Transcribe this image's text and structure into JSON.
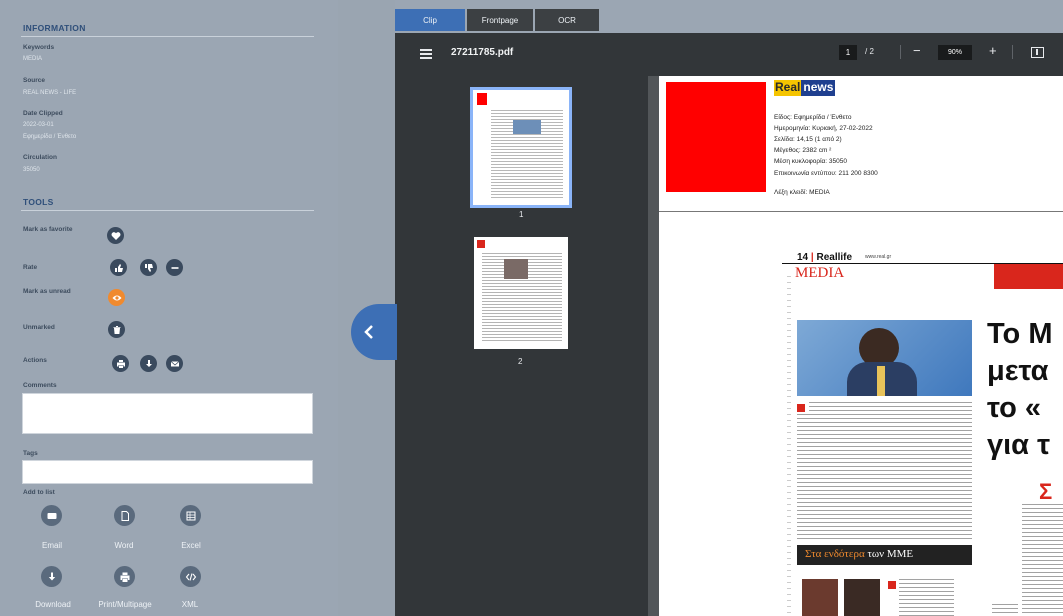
{
  "info": {
    "title": "INFORMATION",
    "fields": [
      {
        "label": "Keywords",
        "value": "MEDIA"
      },
      {
        "label": "Source",
        "value": "REAL NEWS - LIFE"
      },
      {
        "label": "Date Clipped",
        "value": "2022-03-01",
        "value2": "Εφημερίδα / Ένθετο"
      },
      {
        "label": "Circulation",
        "value": "35050"
      }
    ]
  },
  "tools": {
    "title": "TOOLS",
    "mark_favorite": "Mark as favorite",
    "rate": "Rate",
    "mark_unread": "Mark as unread",
    "unmarked": "Unmarked",
    "actions": "Actions",
    "comments": "Comments",
    "tags": "Tags",
    "add_to_list": "Add to list"
  },
  "add_buttons": {
    "email": "Email",
    "word": "Word",
    "excel": "Excel",
    "download": "Download",
    "print": "Print/Multipage",
    "xml": "XML"
  },
  "tabs": [
    "Clip",
    "Frontpage",
    "OCR"
  ],
  "pdf": {
    "filename": "27211785.pdf",
    "current_page": "1",
    "total_pages": "/ 2",
    "zoom": "90%"
  },
  "thumbnails": [
    "1",
    "2"
  ],
  "page_meta": {
    "logo_part1": "Real",
    "logo_part2": "news",
    "lines": [
      "Είδος: Εφημερίδα / Ένθετο",
      "Ημερομηνία: Κυριακή, 27-02-2022",
      "Σελίδα: 14,15        (1 από 2)",
      "Μέγεθος: 2382 cm ²",
      "Μέση κυκλοφορία: 35050",
      "Επικοινωνία εντύπου: 211 200 8300"
    ],
    "keyword_line": "Λέξη κλειδί: MEDIA"
  },
  "newspaper": {
    "page_no": "14",
    "section_brand": "Reallife",
    "url": "www.real.gr",
    "section": "MEDIA",
    "headline_lines": [
      "Το Μ",
      "μετα",
      "το «",
      "για τ"
    ],
    "box_title_a": "Στα ενδότερα",
    "box_title_b": "των ΜΜΕ",
    "sigma": "Σ"
  },
  "colors": {
    "accent_blue": "#3d6fb5",
    "orange": "#f08a2e",
    "red": "#ff0000"
  }
}
